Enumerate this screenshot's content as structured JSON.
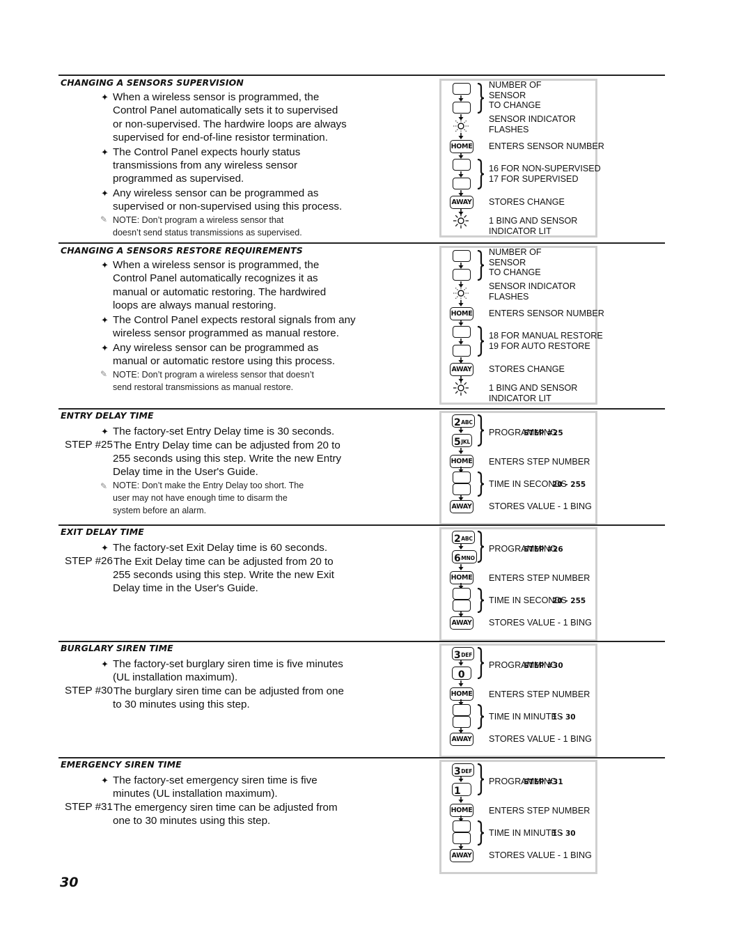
{
  "page_number": "30",
  "sections": [
    {
      "heading": "CHANGING A SENSORS SUPERVISION",
      "bullets": [
        [
          "When a wireless sensor is programmed, the",
          "Control Panel automatically sets it to supervised",
          "or non-supervised. The hardwire loops are always",
          "supervised for end-of-line resistor termination."
        ],
        [
          "The Control Panel expects hourly status",
          "transmissions from any wireless sensor",
          "programmed as supervised."
        ],
        [
          "Any wireless sensor can be programmed as",
          "supervised or non-supervised using this process."
        ]
      ],
      "note": [
        "NOTE: Don’t program a wireless sensor that",
        "doesn’t send status transmissions as supervised."
      ],
      "diagram": {
        "labels": {
          "number_of_sensor": [
            "NUMBER OF",
            "SENSOR",
            "TO CHANGE"
          ],
          "indicator_flashes": [
            "SENSOR INDICATOR",
            "FLASHES"
          ],
          "enter": "ENTERS SENSOR NUMBER",
          "options": [
            "16 FOR NON-SUPERVISED",
            "17 FOR SUPERVISED"
          ],
          "store": "STORES CHANGE",
          "result": [
            "1 BING AND SENSOR",
            "INDICATOR LIT"
          ]
        },
        "keys": {
          "home": "HOME",
          "away": "AWAY"
        }
      }
    },
    {
      "heading": "CHANGING A SENSORS RESTORE REQUIREMENTS",
      "bullets": [
        [
          "When a wireless sensor is programmed, the",
          "Control Panel automatically recognizes it as",
          "manual or automatic restoring. The hardwired",
          "loops are always manual restoring."
        ],
        [
          "The Control Panel expects restoral signals from any",
          "wireless sensor programmed as manual restore."
        ],
        [
          "Any wireless sensor can be programmed as",
          "manual or automatic restore using this process."
        ]
      ],
      "note": [
        "NOTE: Don’t program a wireless sensor that doesn’t",
        "send restoral transmissions as manual restore."
      ],
      "diagram": {
        "labels": {
          "number_of_sensor": [
            "NUMBER OF",
            "SENSOR",
            "TO CHANGE"
          ],
          "indicator_flashes": [
            "SENSOR INDICATOR",
            "FLASHES"
          ],
          "enter": "ENTERS SENSOR NUMBER",
          "options": [
            "18 FOR MANUAL RESTORE",
            "19 FOR AUTO RESTORE"
          ],
          "store": "STORES CHANGE",
          "result": [
            "1 BING AND SENSOR",
            "INDICATOR LIT"
          ]
        },
        "keys": {
          "home": "HOME",
          "away": "AWAY"
        }
      }
    },
    {
      "heading": "ENTRY DELAY TIME",
      "bullet": "The factory-set Entry Delay time is 30 seconds.",
      "step_label": "STEP #25",
      "step_text": [
        "The Entry Delay time can be adjusted from 20 to",
        "255 seconds using this step. Write the new Entry",
        "Delay time in the User's Guide."
      ],
      "note": [
        "NOTE: Don’t make the Entry Delay too short. The",
        "user may not have enough time to disarm the",
        "system before an alarm."
      ],
      "diagram": {
        "key1": {
          "digit": "2",
          "letters": "ABC"
        },
        "key2": {
          "digit": "5",
          "letters": "JKL"
        },
        "prog_label": "PROGRAMMING",
        "prog_step": "STEP #25",
        "enter": "ENTERS STEP NUMBER",
        "time_label": "TIME IN SECONDS",
        "time_range": "20 - 255",
        "store": "STORES VALUE - 1 BING",
        "keys": {
          "home": "HOME",
          "away": "AWAY"
        }
      }
    },
    {
      "heading": "EXIT DELAY TIME",
      "bullet": "The factory-set Exit Delay time is 60 seconds.",
      "step_label": "STEP #26",
      "step_text": [
        "The Exit Delay time can be adjusted from 20 to",
        "255 seconds using this step. Write the new Exit",
        "Delay time in the User's Guide."
      ],
      "diagram": {
        "key1": {
          "digit": "2",
          "letters": "ABC"
        },
        "key2": {
          "digit": "6",
          "letters": "MNO"
        },
        "prog_label": "PROGRAMMING",
        "prog_step": "STEP #26",
        "enter": "ENTERS STEP NUMBER",
        "time_label": "TIME IN SECONDS",
        "time_range": "20 - 255",
        "store": "STORES VALUE - 1 BING",
        "keys": {
          "home": "HOME",
          "away": "AWAY"
        }
      }
    },
    {
      "heading": "BURGLARY SIREN TIME",
      "bullet": [
        "The factory-set burglary siren time is five minutes",
        "(UL installation maximum)."
      ],
      "step_label": "STEP #30",
      "step_text": [
        "The burglary siren time can be adjusted from one",
        "to 30 minutes using this step."
      ],
      "diagram": {
        "key1": {
          "digit": "3",
          "letters": "DEF"
        },
        "key2": {
          "digit": "0",
          "letters": ""
        },
        "prog_label": "PROGRAMMING",
        "prog_step": "STEP #30",
        "enter": "ENTERS STEP NUMBER",
        "time_label": "TIME IN MINUTES",
        "time_range": "1 - 30",
        "store": "STORES VALUE - 1 BING",
        "keys": {
          "home": "HOME",
          "away": "AWAY"
        }
      }
    },
    {
      "heading": "EMERGENCY SIREN TIME",
      "bullet": [
        "The factory-set emergency siren time is five",
        "minutes (UL installation maximum)."
      ],
      "step_label": "STEP #31",
      "step_text": [
        "The emergency siren time can be adjusted from",
        "one to 30 minutes using this step."
      ],
      "diagram": {
        "key1": {
          "digit": "3",
          "letters": "DEF"
        },
        "key2": {
          "digit": "1",
          "letters": ""
        },
        "prog_label": "PROGRAMMING",
        "prog_step": "STEP #31",
        "enter": "ENTERS STEP NUMBER",
        "time_label": "TIME IN MINUTES",
        "time_range": "1 - 30",
        "store": "STORES VALUE - 1 BING",
        "keys": {
          "home": "HOME",
          "away": "AWAY"
        }
      }
    }
  ],
  "icons": {
    "bullet": "✦",
    "note": "✎"
  }
}
